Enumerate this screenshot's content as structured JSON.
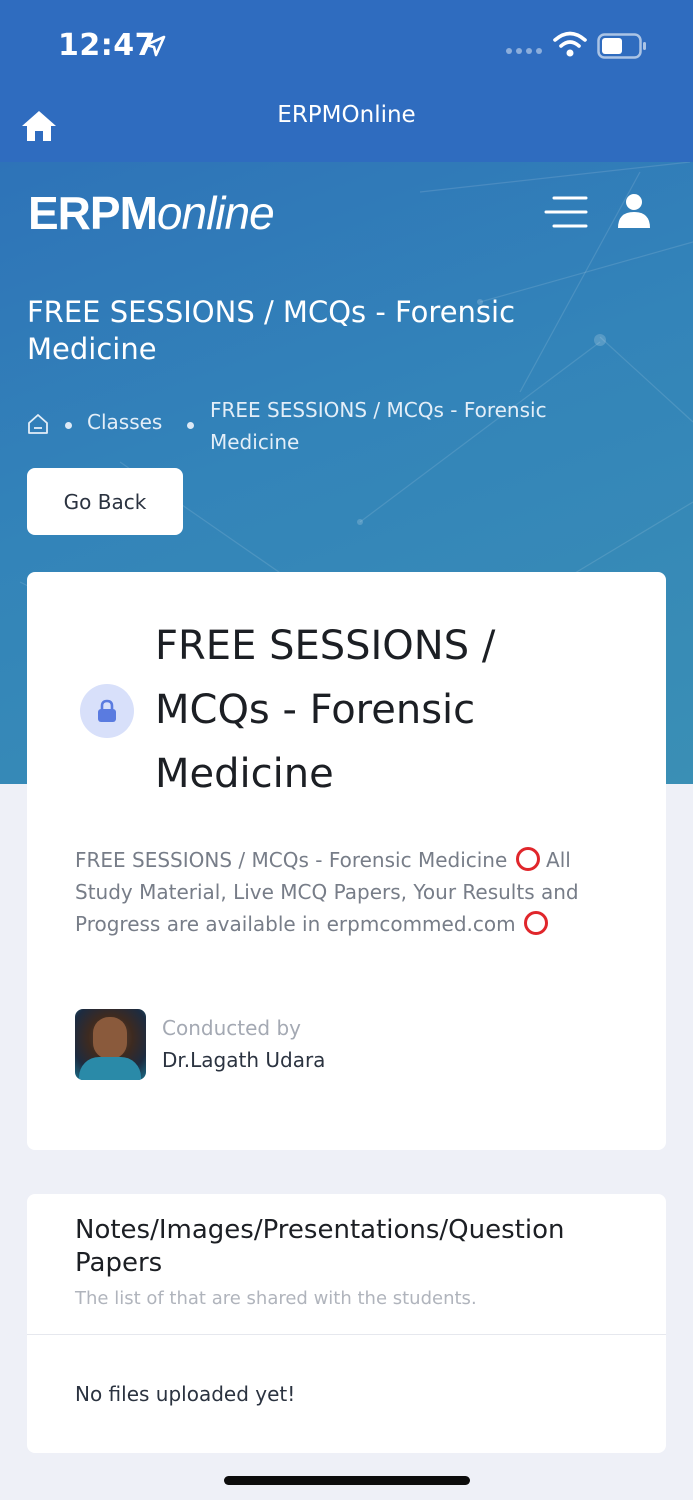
{
  "status_bar": {
    "time": "12:47"
  },
  "nav": {
    "title": "ERPMOnline"
  },
  "header": {
    "logo_bold": "ERPM",
    "logo_italic": "online",
    "title": "FREE SESSIONS / MCQs - Forensic Medicine",
    "breadcrumb": {
      "classes": "Classes",
      "current": "FREE SESSIONS / MCQs - Forensic Medicine"
    },
    "go_back": "Go Back"
  },
  "class_card": {
    "title": "FREE SESSIONS / MCQs - Forensic Medicine",
    "description": "FREE SESSIONS / MCQs - Forensic Medicine",
    "description_2": "All Study Material, Live MCQ Papers, Your Results and Progress are available in erpmcommed.com",
    "conducted_by_label": "Conducted by",
    "conductor_name": "Dr.Lagath Udara"
  },
  "files_card": {
    "title": "Notes/Images/Presentations/Question Papers",
    "subtitle": "The list of that are shared with the students.",
    "empty_message": "No files uploaded yet!"
  },
  "colors": {
    "brand_blue": "#2f6cbf",
    "accent_red": "#e0262b",
    "lock_badge": "#d8e0fa"
  }
}
